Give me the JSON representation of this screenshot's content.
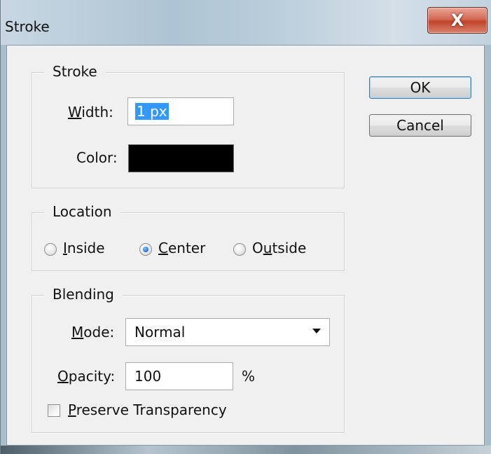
{
  "window": {
    "title": "Stroke",
    "close_label": "X"
  },
  "stroke_group": {
    "legend": "Stroke",
    "width_label_underlined": "W",
    "width_label_rest": "idth:",
    "width_value": "1 px",
    "color_label": "Color:",
    "color_value": "#000000"
  },
  "location_group": {
    "legend": "Location",
    "options": [
      {
        "prefix": "",
        "underlined": "I",
        "suffix": "nside",
        "checked": false
      },
      {
        "prefix": "",
        "underlined": "C",
        "suffix": "enter",
        "checked": true
      },
      {
        "prefix": "O",
        "underlined": "u",
        "suffix": "tside",
        "checked": false
      }
    ]
  },
  "blending_group": {
    "legend": "Blending",
    "mode_label_underlined": "M",
    "mode_label_rest": "ode:",
    "mode_value": "Normal",
    "opacity_label_underlined": "O",
    "opacity_label_rest": "pacity:",
    "opacity_value": "100",
    "opacity_unit": "%",
    "preserve_underlined": "P",
    "preserve_rest": "reserve Transparency",
    "preserve_checked": false
  },
  "buttons": {
    "ok": "OK",
    "cancel": "Cancel"
  }
}
